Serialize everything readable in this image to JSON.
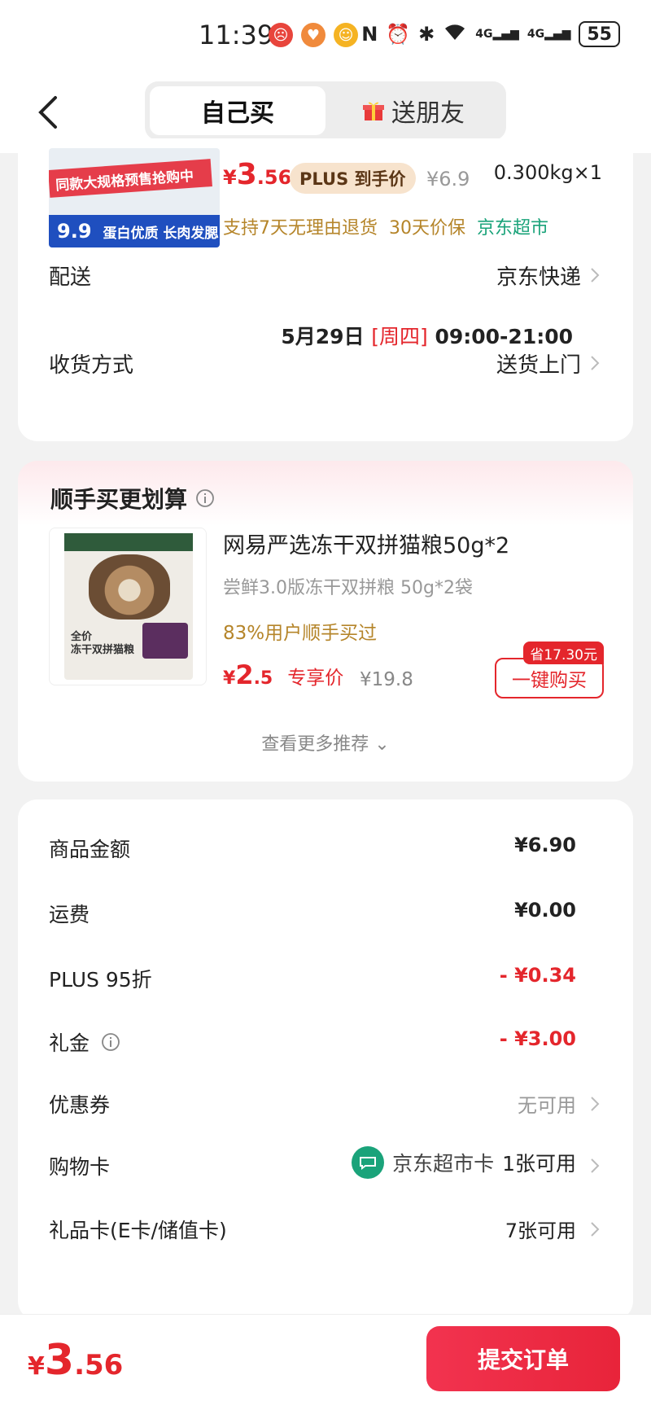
{
  "status_bar": {
    "time": "11:39",
    "signal1": "4G",
    "signal2": "4G",
    "battery": "55"
  },
  "nav": {
    "tab_self": "自己买",
    "tab_gift": "送朋友"
  },
  "product": {
    "banner_text": "同款大规格预售抢购中",
    "promo_big": "9.9",
    "promo_slogan": "蛋白优质 长肉发腮",
    "price_symbol": "¥",
    "price_int": "3",
    "price_dec": ".56",
    "plus_tag": "PLUS 到手价",
    "orig_price": "¥6.9",
    "weight_qty": "0.300kg×1",
    "service_return": "支持7天无理由退货",
    "service_price": "30天价保",
    "service_store": "京东超市"
  },
  "delivery": {
    "label": "配送",
    "method": "京东快递",
    "date": "5月29日",
    "weekday": "[周四]",
    "time": "09:00-21:00"
  },
  "receive": {
    "label": "收货方式",
    "value": "送货上门"
  },
  "recommend": {
    "title": "顺手买更划算",
    "name": "网易严选冻干双拼猫粮50g*2",
    "spec": "尝鲜3.0版冻干双拼粮 50g*2袋",
    "buyers": "83%用户顺手买过",
    "price_symbol": "¥",
    "price_int": "2",
    "price_dec": ".5",
    "price_tag": "专享价",
    "orig_price": "¥19.8",
    "save_badge": "省17.30元",
    "buy_button": "一键购买",
    "more": "查看更多推荐",
    "bag_label1": "全价",
    "bag_label2": "冻干双拼猫粮"
  },
  "fees": {
    "goods_label": "商品金额",
    "goods_value": "¥6.90",
    "shipping_label": "运费",
    "shipping_value": "¥0.00",
    "plus_label": "PLUS 95折",
    "plus_value": "- ¥0.34",
    "gift_cash_label": "礼金",
    "gift_cash_value": "- ¥3.00",
    "coupon_label": "优惠券",
    "coupon_value": "无可用",
    "shopping_card_label": "购物卡",
    "shopping_card_name": "京东超市卡",
    "shopping_card_value": "1张可用",
    "gift_card_label": "礼品卡(E卡/储值卡)",
    "gift_card_value": "7张可用"
  },
  "bottom": {
    "total_symbol": "¥",
    "total_int": "3",
    "total_dec": ".56",
    "submit": "提交订单"
  },
  "colors": {
    "accent_red": "#e4262c",
    "gold_text": "#b5852a",
    "jd_green": "#1aa37a"
  }
}
